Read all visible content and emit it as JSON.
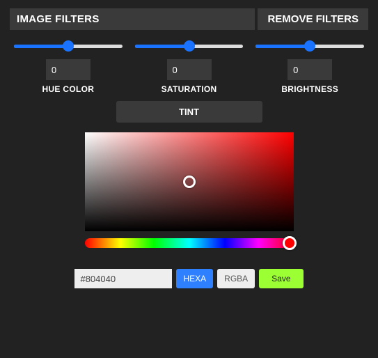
{
  "header": {
    "title": "IMAGE FILTERS",
    "remove_label": "REMOVE FILTERS"
  },
  "sliders": {
    "hue": {
      "value": "0",
      "label": "HUE COLOR",
      "fill_pct": 50
    },
    "saturation": {
      "value": "0",
      "label": "SATURATION",
      "fill_pct": 50
    },
    "brightness": {
      "value": "0",
      "label": "BRIGHTNESS",
      "fill_pct": 50
    }
  },
  "tint": {
    "label": "TINT"
  },
  "picker": {
    "hue_color": "#ff0000",
    "hex_value": "#804040",
    "hexa_label": "HEXA",
    "rgba_label": "RGBA",
    "save_label": "Save"
  }
}
